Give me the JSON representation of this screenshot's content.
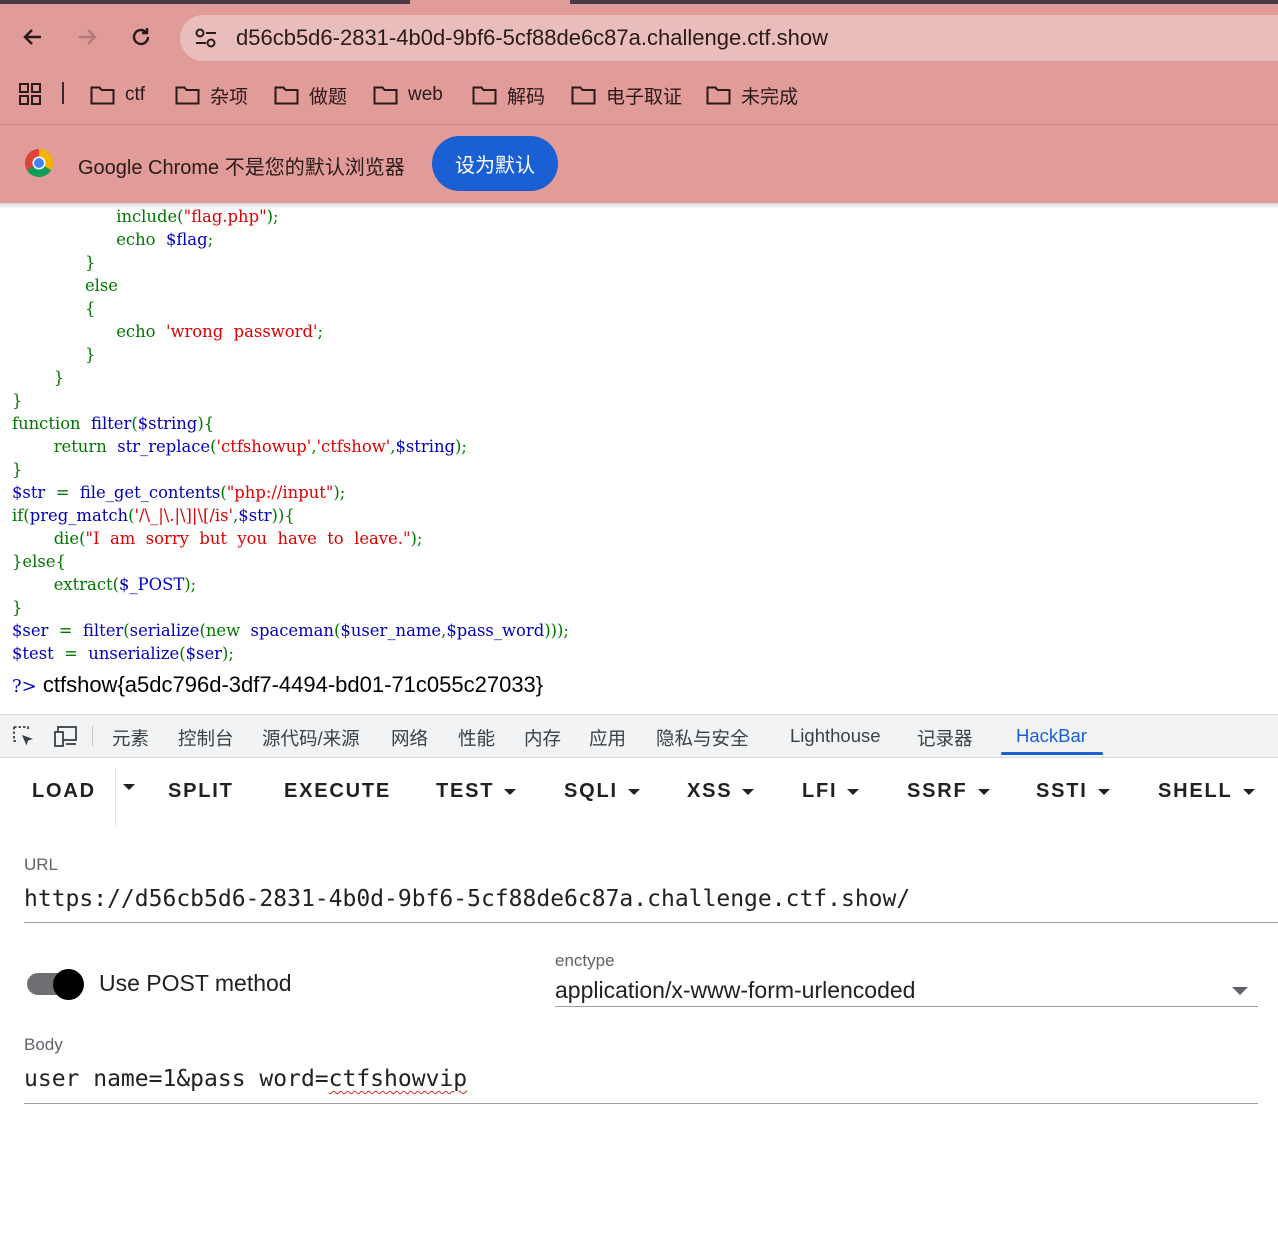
{
  "browser": {
    "url": "d56cb5d6-2831-4b0d-9bf6-5cf88de6c87a.challenge.ctf.show",
    "bookmarks": [
      "ctf",
      "杂项",
      "做题",
      "web",
      "解码",
      "电子取证",
      "未完成"
    ],
    "infobar": {
      "text": "Google Chrome 不是您的默认浏览器",
      "button": "设为默认"
    }
  },
  "source": {
    "lines": [
      {
        "indent": "                    ",
        "parts": [
          [
            "k",
            "include("
          ],
          [
            "s",
            "\"flag.php\""
          ],
          [
            "k",
            ");"
          ]
        ]
      },
      {
        "indent": "                    ",
        "parts": [
          [
            "k",
            "echo  "
          ],
          [
            "v",
            "$flag"
          ],
          [
            "k",
            ";"
          ]
        ]
      },
      {
        "indent": "              ",
        "parts": [
          [
            "k",
            "}"
          ]
        ]
      },
      {
        "indent": "              ",
        "parts": [
          [
            "k",
            "else"
          ]
        ]
      },
      {
        "indent": "              ",
        "parts": [
          [
            "k",
            "{"
          ]
        ]
      },
      {
        "indent": "                    ",
        "parts": [
          [
            "k",
            "echo  "
          ],
          [
            "s",
            "'wrong  password'"
          ],
          [
            "k",
            ";"
          ]
        ]
      },
      {
        "indent": "              ",
        "parts": [
          [
            "k",
            "}"
          ]
        ]
      },
      {
        "indent": "        ",
        "parts": [
          [
            "k",
            "}"
          ]
        ]
      },
      {
        "indent": "",
        "parts": [
          [
            "k",
            "}"
          ]
        ]
      },
      {
        "indent": "",
        "parts": [
          [
            "k",
            "function  "
          ],
          [
            "v",
            "filter"
          ],
          [
            "k",
            "("
          ],
          [
            "v",
            "$string"
          ],
          [
            "k",
            "){"
          ]
        ]
      },
      {
        "indent": "        ",
        "parts": [
          [
            "k",
            "return  "
          ],
          [
            "v",
            "str_replace"
          ],
          [
            "k",
            "("
          ],
          [
            "s",
            "'ctfshowup'"
          ],
          [
            "k",
            ","
          ],
          [
            "s",
            "'ctfshow'"
          ],
          [
            "k",
            ","
          ],
          [
            "v",
            "$string"
          ],
          [
            "k",
            ");"
          ]
        ]
      },
      {
        "indent": "",
        "parts": [
          [
            "k",
            "}"
          ]
        ]
      },
      {
        "indent": "",
        "parts": [
          [
            "v",
            "$str  "
          ],
          [
            "k",
            "=  "
          ],
          [
            "v",
            "file_get_contents"
          ],
          [
            "k",
            "("
          ],
          [
            "s",
            "\"php://input\""
          ],
          [
            "k",
            ");"
          ]
        ]
      },
      {
        "indent": "",
        "parts": [
          [
            "k",
            "if("
          ],
          [
            "v",
            "preg_match"
          ],
          [
            "k",
            "("
          ],
          [
            "s",
            "'/\\_|\\.|\\]|\\[/is'"
          ],
          [
            "k",
            ","
          ],
          [
            "v",
            "$str"
          ],
          [
            "k",
            "))"
          ],
          [
            "k",
            "{"
          ]
        ]
      },
      {
        "indent": "        ",
        "parts": [
          [
            "k",
            "die("
          ],
          [
            "s",
            "\"I  am  sorry  but  you  have  to  leave.\""
          ],
          [
            "k",
            ");"
          ]
        ]
      },
      {
        "indent": "",
        "parts": [
          [
            "k",
            "}else{"
          ]
        ]
      },
      {
        "indent": "        ",
        "parts": [
          [
            "k",
            "extract("
          ],
          [
            "v",
            "$_POST"
          ],
          [
            "k",
            ");"
          ]
        ]
      },
      {
        "indent": "",
        "parts": [
          [
            "k",
            "}"
          ]
        ]
      },
      {
        "indent": "",
        "parts": [
          [
            "v",
            "$ser  "
          ],
          [
            "k",
            "=  "
          ],
          [
            "v",
            "filter"
          ],
          [
            "k",
            "("
          ],
          [
            "v",
            "serialize"
          ],
          [
            "k",
            "(new  "
          ],
          [
            "v",
            "spaceman"
          ],
          [
            "k",
            "("
          ],
          [
            "v",
            "$user_name"
          ],
          [
            "k",
            ","
          ],
          [
            "v",
            "$pass_word"
          ],
          [
            "k",
            ")));"
          ]
        ]
      },
      {
        "indent": "",
        "parts": [
          [
            "v",
            "$test  "
          ],
          [
            "k",
            "=  "
          ],
          [
            "v",
            "unserialize"
          ],
          [
            "k",
            "("
          ],
          [
            "v",
            "$ser"
          ],
          [
            "k",
            ");"
          ]
        ]
      }
    ],
    "close_tag": "?>",
    "flag": "ctfshow{a5dc796d-3df7-4494-bd01-71c055c27033}"
  },
  "devtools": {
    "tabs": [
      "元素",
      "控制台",
      "源代码/来源",
      "网络",
      "性能",
      "内存",
      "应用",
      "隐私与安全",
      "Lighthouse",
      "记录器",
      "HackBar"
    ],
    "active_tab": "HackBar"
  },
  "hackbar": {
    "buttons": {
      "load": "LOAD",
      "split": "SPLIT",
      "execute": "EXECUTE",
      "test": "TEST",
      "sqli": "SQLI",
      "xss": "XSS",
      "lfi": "LFI",
      "ssrf": "SSRF",
      "ssti": "SSTI",
      "shell": "SHELL"
    },
    "url_label": "URL",
    "url_value": "https://d56cb5d6-2831-4b0d-9bf6-5cf88de6c87a.challenge.ctf.show/",
    "post_toggle_label": "Use POST method",
    "post_enabled": true,
    "enctype_label": "enctype",
    "enctype_value": "application/x-www-form-urlencoded",
    "body_label": "Body",
    "body_prefix": "user name=1&pass word=",
    "body_suffix": "ctfshowvip"
  },
  "colors": {
    "chrome_bg": "#e19b98",
    "accent": "#1a5fd3",
    "php_keyword": "#007700",
    "php_variable": "#0000bb",
    "php_string": "#dd0000"
  }
}
